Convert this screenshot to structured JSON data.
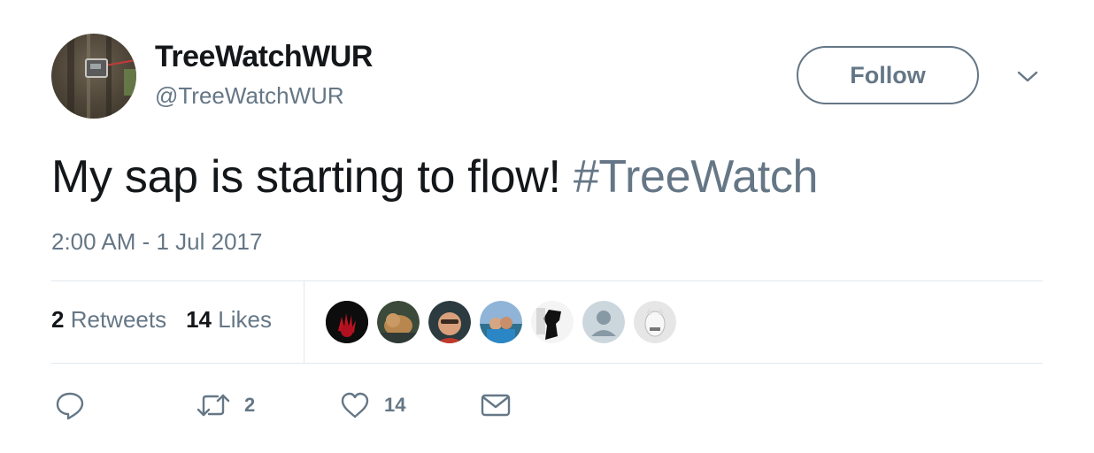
{
  "account": {
    "name": "TreeWatchWUR",
    "handle": "@TreeWatchWUR",
    "avatar_icon": "tree-sensor-avatar"
  },
  "follow_button": {
    "label": "Follow"
  },
  "menu_caret": {
    "icon": "chevron-down-icon"
  },
  "tweet": {
    "text": "My sap is starting to flow!",
    "hashtag": "#TreeWatch",
    "timestamp": "2:00 AM - 1 Jul 2017"
  },
  "stats": {
    "retweets_count": "2",
    "retweets_label": "Retweets",
    "likes_count": "14",
    "likes_label": "Likes"
  },
  "likers": [
    {
      "kind": "red-hand-avatar"
    },
    {
      "kind": "cat-avatar"
    },
    {
      "kind": "person-avatar"
    },
    {
      "kind": "couple-avatar"
    },
    {
      "kind": "silhouette-avatar"
    },
    {
      "kind": "default-avatar"
    },
    {
      "kind": "goat-avatar"
    }
  ],
  "actions": {
    "reply_icon": "reply-icon",
    "retweet_icon": "retweet-icon",
    "retweet_count": "2",
    "like_icon": "heart-icon",
    "like_count": "14",
    "dm_icon": "envelope-icon"
  },
  "colors": {
    "text": "#14171a",
    "secondary": "#657786",
    "divider": "#e1e8ed"
  }
}
